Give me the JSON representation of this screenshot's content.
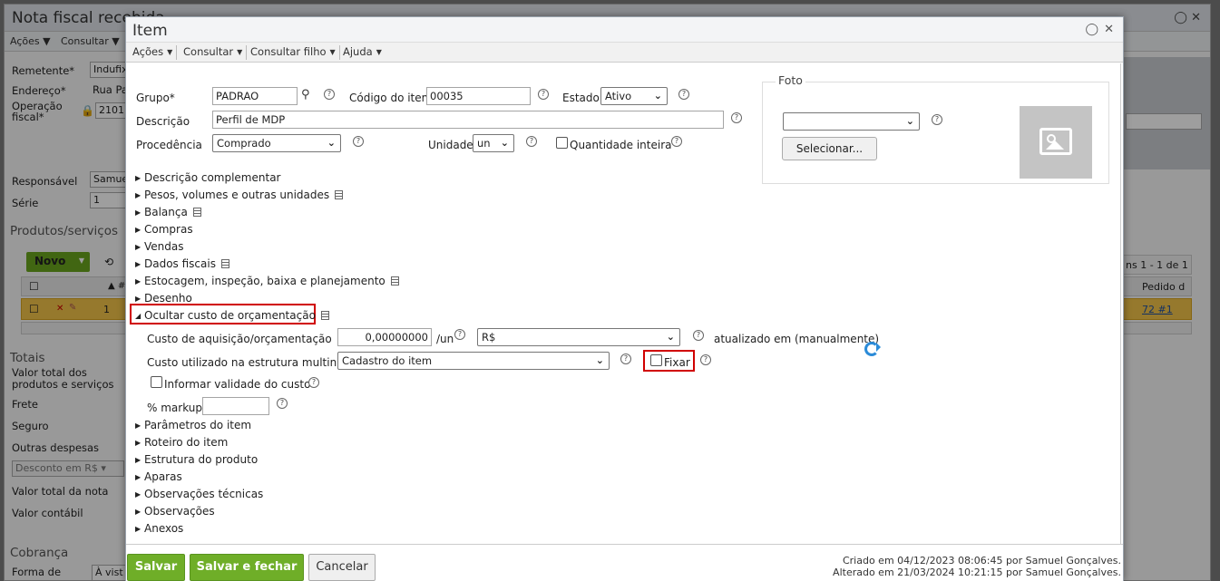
{
  "background": {
    "title": "Nota fiscal recebida",
    "menu": [
      "Ações",
      "Consultar"
    ],
    "fields": {
      "remetente_label": "Remetente*",
      "remetente_value": "Indufix",
      "endereco_label": "Endereço*",
      "endereco_value": "Rua Pa",
      "operacao_label_1": "Operação",
      "operacao_label_2": "fiscal*",
      "operacao_value": "2101",
      "responsavel_label": "Responsável",
      "responsavel_value": "Samue",
      "serie_label": "Série",
      "serie_value": "1"
    },
    "produtos_title": "Produtos/serviços",
    "novo_label": "Novo",
    "grid_head_cols": [
      "▲ #"
    ],
    "grid_row_num": "1",
    "right_pager": "ns 1 - 1 de 1",
    "right_head": "Pedido d",
    "right_row_link": "72 #1",
    "totais_title": "Totais",
    "totais": [
      "Valor total dos",
      "produtos e serviços",
      "Frete",
      "Seguro",
      "Outras despesas"
    ],
    "desconto": "Desconto em R$",
    "totais2": [
      "Valor total da nota",
      "Valor contábil"
    ],
    "cobranca_title": "Cobrança",
    "forma_label": "Forma de",
    "forma_value": "À vist"
  },
  "dialog": {
    "title": "Item",
    "menu": [
      {
        "label": "Ações"
      },
      {
        "label": "Consultar"
      },
      {
        "label": "Consultar filho"
      },
      {
        "label": "Ajuda"
      }
    ],
    "grupo_label": "Grupo*",
    "grupo_value": "PADRAO",
    "codigo_label": "Código do item",
    "codigo_value": "00035",
    "estado_label": "Estado",
    "estado_value": "Ativo",
    "descricao_label": "Descrição",
    "descricao_value": "Perfil de MDP",
    "procedencia_label": "Procedência",
    "procedencia_value": "Comprado",
    "unidade_label": "Unidade",
    "unidade_value": "un",
    "quantidade_inteira_label": "Quantidade inteira",
    "foto_label": "Foto",
    "foto_select_value": "",
    "selecionar_label": "Selecionar...",
    "sections_top": [
      {
        "label": "Descrição complementar",
        "note": false
      },
      {
        "label": "Pesos, volumes e outras unidades",
        "note": true
      },
      {
        "label": "Balança",
        "note": true
      },
      {
        "label": "Compras",
        "note": false
      },
      {
        "label": "Vendas",
        "note": false
      },
      {
        "label": "Dados fiscais",
        "note": true
      },
      {
        "label": "Estocagem, inspeção, baixa e planejamento",
        "note": true
      },
      {
        "label": "Desenho",
        "note": false
      }
    ],
    "open_section_label": "Ocultar custo de orçamentação",
    "custo_label": "Custo de aquisição/orçamentação",
    "custo_value": "0,00000000",
    "custo_unit": "/un",
    "moeda_value": "R$",
    "atualizado_label": "atualizado em (manualmente)",
    "custo_multi_label": "Custo utilizado na estrutura multinível",
    "custo_multi_value": "Cadastro do item",
    "fixar_label": "Fixar",
    "informar_validade_label": "Informar validade do custo",
    "markup_label": "% markup",
    "markup_value": "",
    "sections_bottom": [
      "Parâmetros do item",
      "Roteiro do item",
      "Estrutura do produto",
      "Aparas",
      "Observações técnicas",
      "Observações",
      "Anexos"
    ],
    "footer": {
      "salvar": "Salvar",
      "salvar_fechar": "Salvar e fechar",
      "cancelar": "Cancelar",
      "criado": "Criado em 04/12/2023 08:06:45 por Samuel Gonçalves.",
      "alterado": "Alterado em 21/03/2024 10:21:15 por Samuel Gonçalves."
    }
  },
  "colors": {
    "accent_green": "#6fae28",
    "highlight_red": "#d00000",
    "row_yellow": "#f2c349",
    "refresh_blue": "#2b8bd8"
  }
}
